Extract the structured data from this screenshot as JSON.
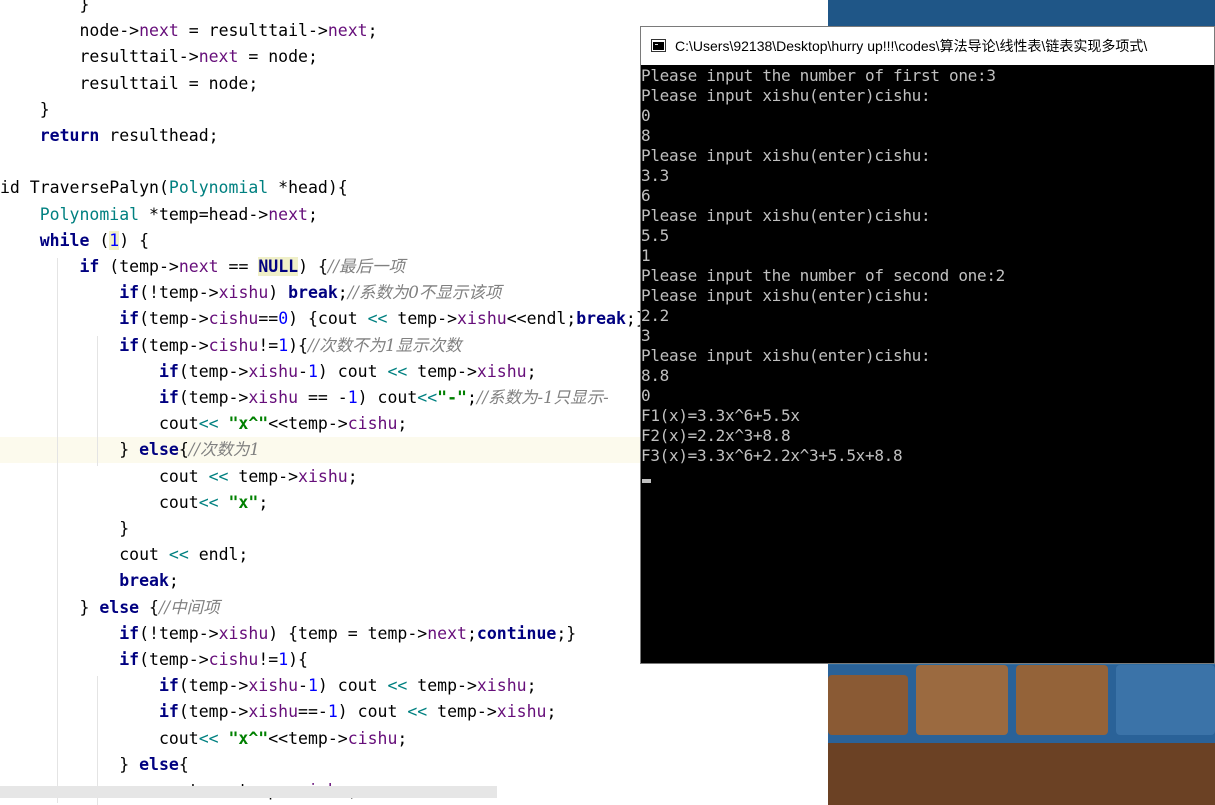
{
  "console": {
    "title": "C:\\Users\\92138\\Desktop\\hurry up!!!\\codes\\算法导论\\线性表\\链表实现多项式\\",
    "lines": [
      "Please input the number of first one:3",
      "Please input xishu(enter)cishu:",
      "0",
      "8",
      "Please input xishu(enter)cishu:",
      "3.3",
      "6",
      "Please input xishu(enter)cishu:",
      "5.5",
      "1",
      "Please input the number of second one:2",
      "Please input xishu(enter)cishu:",
      "2.2",
      "3",
      "Please input xishu(enter)cishu:",
      "8.8",
      "0",
      "F1(x)=3.3x^6+5.5x",
      "F2(x)=2.2x^3+8.8",
      "F3(x)=3.3x^6+2.2x^3+5.5x+8.8"
    ]
  },
  "editor": {
    "lines": [
      [
        [
          "p",
          "        }"
        ]
      ],
      [
        [
          "p",
          "        node->"
        ],
        [
          "f",
          "next"
        ],
        [
          "p",
          " = resulttail->"
        ],
        [
          "f",
          "next"
        ],
        [
          "p",
          ";"
        ]
      ],
      [
        [
          "p",
          "        resulttail->"
        ],
        [
          "f",
          "next"
        ],
        [
          "p",
          " = node;"
        ]
      ],
      [
        [
          "p",
          "        resulttail = node;"
        ]
      ],
      [
        [
          "p",
          "    }"
        ]
      ],
      [
        [
          "p",
          "    "
        ],
        [
          "k",
          "return"
        ],
        [
          "p",
          " resulthead;"
        ]
      ],
      [
        [
          "p",
          ""
        ]
      ],
      [
        [
          "p",
          "id TraversePalyn("
        ],
        [
          "t",
          "Polynomial"
        ],
        [
          "p",
          " *head){"
        ]
      ],
      [
        [
          "p",
          "    "
        ],
        [
          "t",
          "Polynomial"
        ],
        [
          "p",
          " *temp=head->"
        ],
        [
          "f",
          "next"
        ],
        [
          "p",
          ";"
        ]
      ],
      [
        [
          "p",
          "    "
        ],
        [
          "k",
          "while"
        ],
        [
          "p",
          " ("
        ],
        [
          "nh",
          "1"
        ],
        [
          "p",
          ") {"
        ]
      ],
      [
        [
          "p",
          "        "
        ],
        [
          "k",
          "if"
        ],
        [
          "p",
          " (temp->"
        ],
        [
          "f",
          "next"
        ],
        [
          "p",
          " == "
        ],
        [
          "m",
          "NULL"
        ],
        [
          "p",
          ") {"
        ],
        [
          "c",
          "//最后一项"
        ]
      ],
      [
        [
          "p",
          "            "
        ],
        [
          "k",
          "if"
        ],
        [
          "p",
          "(!temp->"
        ],
        [
          "f",
          "xishu"
        ],
        [
          "p",
          ") "
        ],
        [
          "k",
          "break"
        ],
        [
          "p",
          ";"
        ],
        [
          "c",
          "//系数为0不显示该项"
        ]
      ],
      [
        [
          "p",
          "            "
        ],
        [
          "k",
          "if"
        ],
        [
          "p",
          "(temp->"
        ],
        [
          "f",
          "cishu"
        ],
        [
          "p",
          "=="
        ],
        [
          "n",
          "0"
        ],
        [
          "p",
          ") {cout "
        ],
        [
          "t",
          "<<"
        ],
        [
          "p",
          " temp->"
        ],
        [
          "f",
          "xishu"
        ],
        [
          "p",
          "<<endl;"
        ],
        [
          "k",
          "break"
        ],
        [
          "p",
          ";} "
        ],
        [
          "c",
          "/"
        ]
      ],
      [
        [
          "p",
          "            "
        ],
        [
          "k",
          "if"
        ],
        [
          "p",
          "(temp->"
        ],
        [
          "f",
          "cishu"
        ],
        [
          "p",
          "!="
        ],
        [
          "n",
          "1"
        ],
        [
          "p",
          "){"
        ],
        [
          "c",
          "//次数不为1显示次数"
        ]
      ],
      [
        [
          "p",
          "                "
        ],
        [
          "k",
          "if"
        ],
        [
          "p",
          "(temp->"
        ],
        [
          "f",
          "xishu"
        ],
        [
          "p",
          "-"
        ],
        [
          "n",
          "1"
        ],
        [
          "p",
          ") cout "
        ],
        [
          "t",
          "<<"
        ],
        [
          "p",
          " temp->"
        ],
        [
          "f",
          "xishu"
        ],
        [
          "p",
          ";"
        ]
      ],
      [
        [
          "p",
          "                "
        ],
        [
          "k",
          "if"
        ],
        [
          "p",
          "(temp->"
        ],
        [
          "f",
          "xishu"
        ],
        [
          "p",
          " == -"
        ],
        [
          "n",
          "1"
        ],
        [
          "p",
          ") cout"
        ],
        [
          "t",
          "<<"
        ],
        [
          "s",
          "\"-\""
        ],
        [
          "p",
          ";"
        ],
        [
          "c",
          "//系数为-1只显示-"
        ]
      ],
      [
        [
          "p",
          "                cout"
        ],
        [
          "t",
          "<<"
        ],
        [
          "p",
          " "
        ],
        [
          "s",
          "\"x^\""
        ],
        [
          "p",
          "<<temp->"
        ],
        [
          "f",
          "cishu"
        ],
        [
          "p",
          ";"
        ]
      ],
      [
        [
          "p",
          "            } "
        ],
        [
          "k",
          "else"
        ],
        [
          "p",
          "{"
        ],
        [
          "c",
          "//次数为1"
        ]
      ],
      [
        [
          "p",
          "                cout "
        ],
        [
          "t",
          "<<"
        ],
        [
          "p",
          " temp->"
        ],
        [
          "f",
          "xishu"
        ],
        [
          "p",
          ";"
        ]
      ],
      [
        [
          "p",
          "                cout"
        ],
        [
          "t",
          "<<"
        ],
        [
          "p",
          " "
        ],
        [
          "s",
          "\"x\""
        ],
        [
          "p",
          ";"
        ]
      ],
      [
        [
          "p",
          "            }"
        ]
      ],
      [
        [
          "p",
          "            cout "
        ],
        [
          "t",
          "<<"
        ],
        [
          "p",
          " endl;"
        ]
      ],
      [
        [
          "p",
          "            "
        ],
        [
          "k",
          "break"
        ],
        [
          "p",
          ";"
        ]
      ],
      [
        [
          "p",
          "        } "
        ],
        [
          "k",
          "else"
        ],
        [
          "p",
          " {"
        ],
        [
          "c",
          "//中间项"
        ]
      ],
      [
        [
          "p",
          "            "
        ],
        [
          "k",
          "if"
        ],
        [
          "p",
          "(!temp->"
        ],
        [
          "f",
          "xishu"
        ],
        [
          "p",
          ") {temp = temp->"
        ],
        [
          "f",
          "next"
        ],
        [
          "p",
          ";"
        ],
        [
          "k",
          "continue"
        ],
        [
          "p",
          ";}"
        ]
      ],
      [
        [
          "p",
          "            "
        ],
        [
          "k",
          "if"
        ],
        [
          "p",
          "(temp->"
        ],
        [
          "f",
          "cishu"
        ],
        [
          "p",
          "!="
        ],
        [
          "n",
          "1"
        ],
        [
          "p",
          "){"
        ]
      ],
      [
        [
          "p",
          "                "
        ],
        [
          "k",
          "if"
        ],
        [
          "p",
          "(temp->"
        ],
        [
          "f",
          "xishu"
        ],
        [
          "p",
          "-"
        ],
        [
          "n",
          "1"
        ],
        [
          "p",
          ") cout "
        ],
        [
          "t",
          "<<"
        ],
        [
          "p",
          " temp->"
        ],
        [
          "f",
          "xishu"
        ],
        [
          "p",
          ";"
        ]
      ],
      [
        [
          "p",
          "                "
        ],
        [
          "k",
          "if"
        ],
        [
          "p",
          "(temp->"
        ],
        [
          "f",
          "xishu"
        ],
        [
          "p",
          "==-"
        ],
        [
          "n",
          "1"
        ],
        [
          "p",
          ") cout "
        ],
        [
          "t",
          "<<"
        ],
        [
          "p",
          " temp->"
        ],
        [
          "f",
          "xishu"
        ],
        [
          "p",
          ";"
        ]
      ],
      [
        [
          "p",
          "                cout"
        ],
        [
          "t",
          "<<"
        ],
        [
          "p",
          " "
        ],
        [
          "s",
          "\"x^\""
        ],
        [
          "p",
          "<<temp->"
        ],
        [
          "f",
          "cishu"
        ],
        [
          "p",
          ";"
        ]
      ],
      [
        [
          "p",
          "            } "
        ],
        [
          "k",
          "else"
        ],
        [
          "p",
          "{"
        ]
      ],
      [
        [
          "p",
          "                cout "
        ],
        [
          "t",
          "<<"
        ],
        [
          "p",
          " temp->"
        ],
        [
          "f",
          "xishu"
        ],
        [
          "p",
          ";"
        ]
      ]
    ]
  }
}
